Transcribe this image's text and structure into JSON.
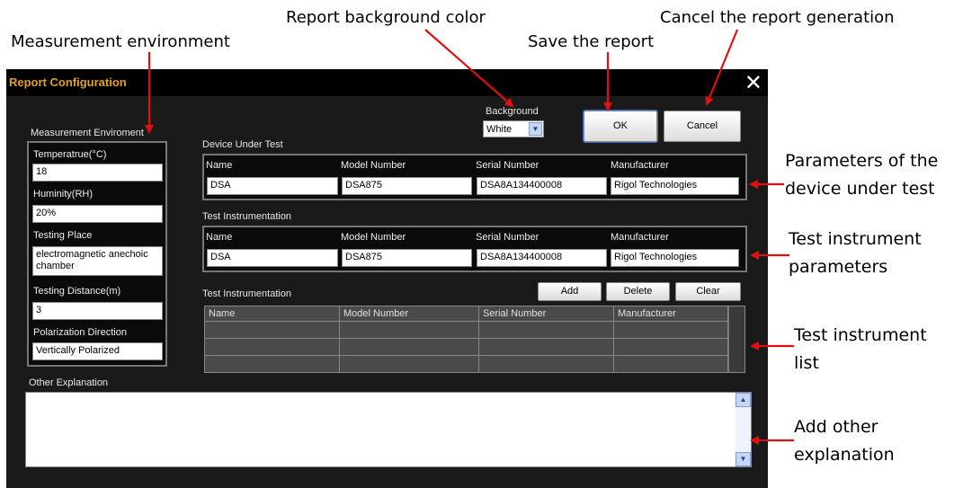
{
  "annotations": {
    "measurement_environment": "Measurement environment",
    "report_background": "Report background color",
    "save_report": "Save the report",
    "cancel_report": "Cancel the report generation",
    "dut_params_1": "Parameters of the",
    "dut_params_2": "device under test",
    "test_instr_params_1": "Test instrument",
    "test_instr_params_2": "parameters",
    "test_instr_list_1": "Test instrument",
    "test_instr_list_2": "list",
    "other_expl_1": "Add other",
    "other_expl_2": "explanation",
    "arrow_color": "#e01010"
  },
  "window": {
    "title": "Report Configuration",
    "close_glyph": "✕"
  },
  "background": {
    "label": "Background",
    "selected": "White"
  },
  "buttons": {
    "ok": "OK",
    "cancel": "Cancel",
    "add": "Add",
    "delete": "Delete",
    "clear": "Clear"
  },
  "environment": {
    "section_label": "Measurement Enviroment",
    "temperature_label": "Temperatrue(°C)",
    "temperature_value": "18",
    "humidity_label": "Huminity(RH)",
    "humidity_value": "20%",
    "place_label": "Testing Place",
    "place_value": "electromagnetic anechoic chamber",
    "distance_label": "Testing Distance(m)",
    "distance_value": "3",
    "polarization_label": "Polarization Direction",
    "polarization_value": "Vertically Polarized"
  },
  "dut": {
    "section_label": "Device Under Test",
    "name_label": "Name",
    "model_label": "Model Number",
    "serial_label": "Serial Number",
    "manufacturer_label": "Manufacturer",
    "name_value": "DSA",
    "model_value": "DSA875",
    "serial_value": "DSA8A134400008",
    "manufacturer_value": "Rigol Technologies"
  },
  "instrument": {
    "section_label": "Test Instrumentation",
    "name_label": "Name",
    "model_label": "Model Number",
    "serial_label": "Serial Number",
    "manufacturer_label": "Manufacturer",
    "name_value": "DSA",
    "model_value": "DSA875",
    "serial_value": "DSA8A134400008",
    "manufacturer_value": "Rigol Technologies"
  },
  "instrument_list": {
    "section_label": "Test Instrumentation",
    "columns": [
      "Name",
      "Model Number",
      "Serial Number",
      "Manufacturer"
    ]
  },
  "other": {
    "label": "Other  Explanation"
  },
  "icons": {
    "dropdown": "▼",
    "scroll_up": "▲",
    "scroll_down": "▼"
  }
}
